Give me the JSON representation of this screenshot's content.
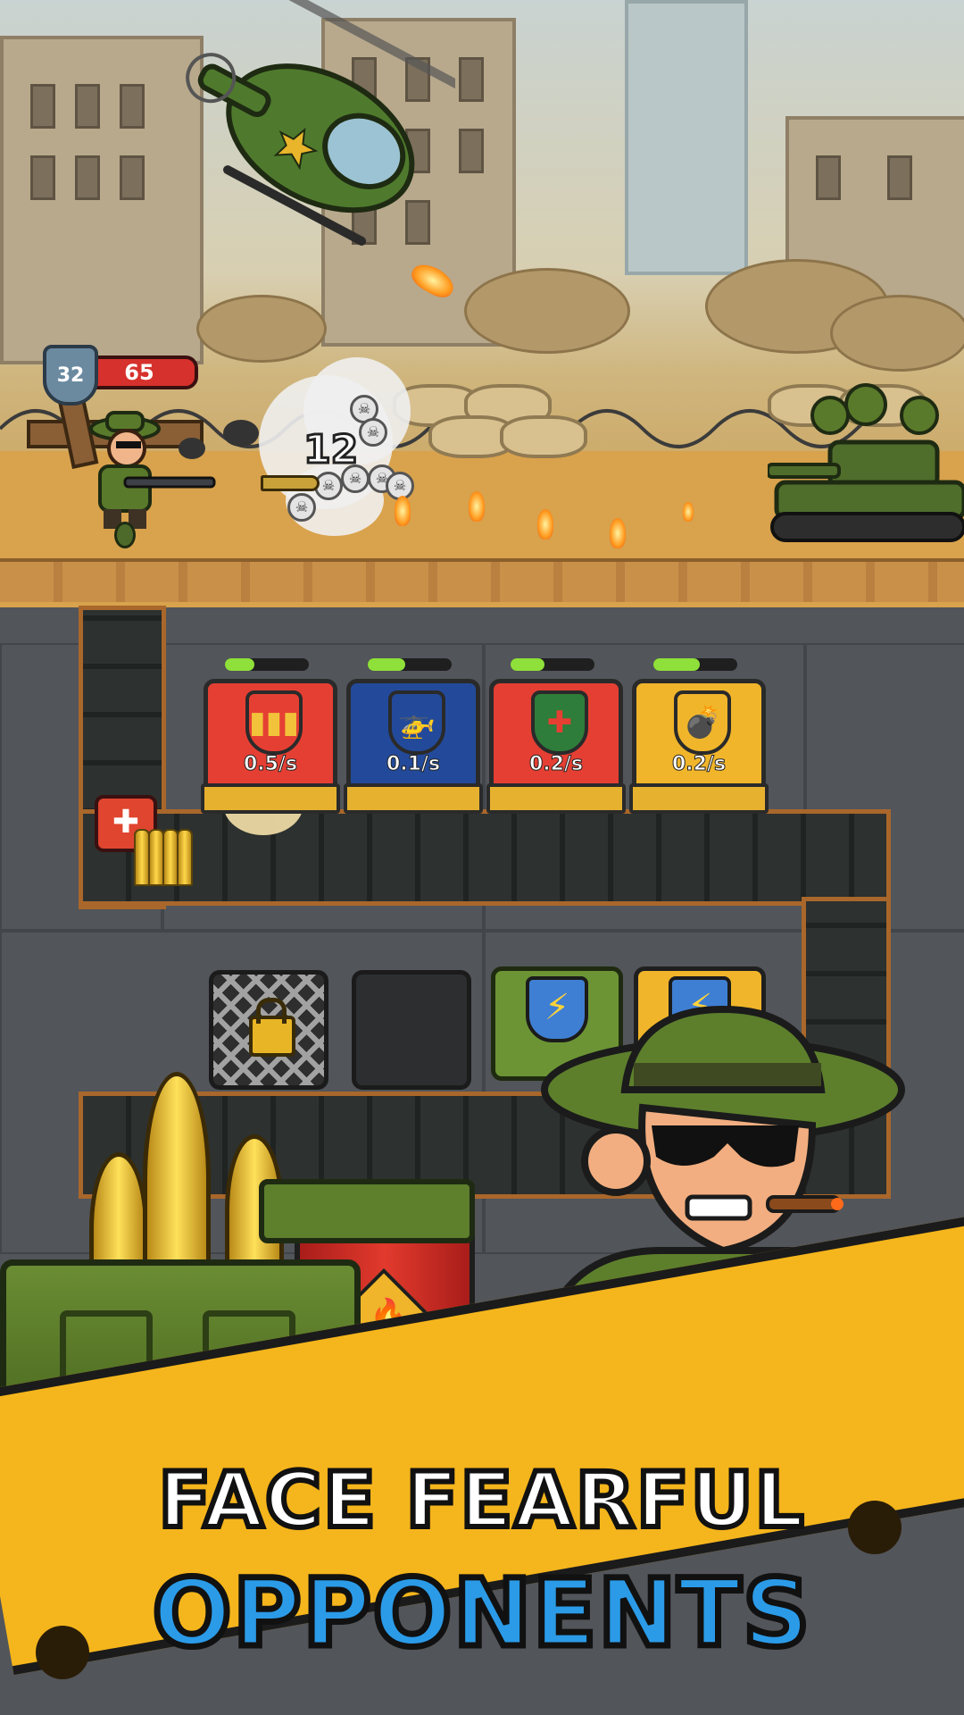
{
  "player": {
    "level": "32",
    "health": "65"
  },
  "damage_number": "12",
  "machines": [
    {
      "name": "bullets",
      "rate": "0.5/s",
      "progress": 0.35,
      "icon": "bullets-icon",
      "color": "#e53f33"
    },
    {
      "name": "helicopter",
      "rate": "0.1/s",
      "progress": 0.45,
      "icon": "helicopter-icon",
      "color": "#234a9a"
    },
    {
      "name": "medkit",
      "rate": "0.2/s",
      "progress": 0.4,
      "icon": "medkit-icon",
      "color": "#e53f33"
    },
    {
      "name": "bomb",
      "rate": "0.2/s",
      "progress": 0.55,
      "icon": "bomb-icon",
      "color": "#f0b52a"
    }
  ],
  "slots": [
    {
      "state": "locked",
      "icon": "lock-icon"
    },
    {
      "state": "empty"
    },
    {
      "state": "upgrade",
      "icon": "lightning-icon"
    },
    {
      "state": "upgrade",
      "icon": "lightning-icon"
    }
  ],
  "banner": {
    "line1": "FACE FEARFUL",
    "line2": "OPPONENTS"
  },
  "colors": {
    "banner": "#f5b51c",
    "accent_blue": "#2b9be8",
    "health": "#d6312c",
    "progress": "#8fe03a"
  }
}
